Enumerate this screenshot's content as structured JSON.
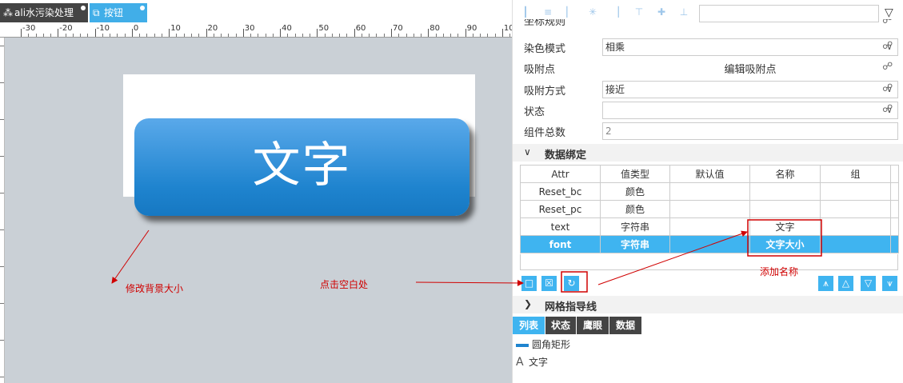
{
  "tabs": [
    {
      "label": "ali水污染处理",
      "icon": "component-icon"
    },
    {
      "label": "按钮",
      "icon": "link-shapes-icon"
    }
  ],
  "ruler": {
    "labels": [
      "-30",
      "-20",
      "-10",
      "0",
      "10",
      "20",
      "30",
      "40",
      "50",
      "60",
      "70",
      "80",
      "90",
      "10"
    ]
  },
  "canvas": {
    "button_text": "文字"
  },
  "annotations": {
    "resize_bg": "修改背景大小",
    "click_blank": "点击空白处",
    "add_name": "添加名称"
  },
  "properties": {
    "partial_label": "坐标规则",
    "blend_mode_label": "染色模式",
    "blend_mode_value": "相乘",
    "snap_point_label": "吸附点",
    "snap_point_action": "编辑吸附点",
    "snap_method_label": "吸附方式",
    "snap_method_value": "接近",
    "state_label": "状态",
    "state_value": "",
    "count_label": "组件总数",
    "count_value": "2"
  },
  "data_binding": {
    "title": "数据绑定",
    "columns": [
      "Attr",
      "值类型",
      "默认值",
      "名称",
      "组"
    ],
    "rows": [
      [
        "Reset_bc",
        "颜色",
        "",
        "",
        ""
      ],
      [
        "Reset_pc",
        "颜色",
        "",
        "",
        ""
      ],
      [
        "text",
        "字符串",
        "",
        "文字",
        ""
      ],
      [
        "font",
        "字符串",
        "",
        "文字大小",
        ""
      ]
    ],
    "selected_row": 3
  },
  "grid_section": {
    "title": "网格指导线"
  },
  "bottom_tabs": [
    "列表",
    "状态",
    "鹰眼",
    "数据"
  ],
  "list_items": [
    {
      "label": "圆角矩形",
      "icon": "rounded-rect-icon"
    },
    {
      "label": "文字",
      "icon": "text-icon"
    }
  ],
  "colors": {
    "accent": "#3fb4f0",
    "annotation": "#d00000",
    "canvas_bg": "#cad0d6"
  }
}
